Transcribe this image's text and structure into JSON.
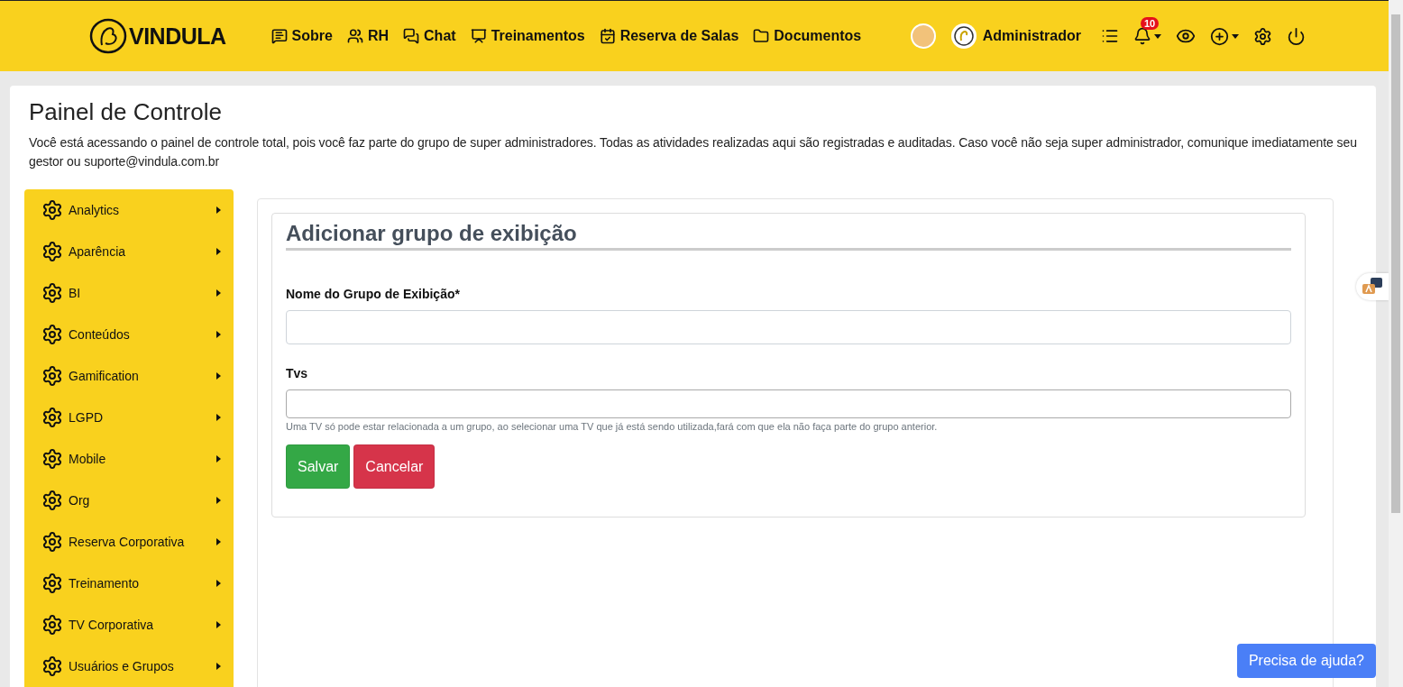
{
  "header": {
    "logo": "VINDULA",
    "nav": [
      {
        "kind": "info",
        "label": "Sobre"
      },
      {
        "kind": "people",
        "label": "RH"
      },
      {
        "kind": "chat",
        "label": "Chat"
      },
      {
        "kind": "training",
        "label": "Treinamentos"
      },
      {
        "kind": "calendar",
        "label": "Reserva de Salas"
      },
      {
        "kind": "folder",
        "label": "Documentos"
      }
    ],
    "user": "Administrador",
    "notifications": "10"
  },
  "page": {
    "title": "Painel de Controle",
    "description": "Você está acessando o painel de controle total, pois você faz parte do grupo de super administradores. Todas as atividades realizadas aqui são registradas e auditadas. Caso você não seja super administrador, comunique imediatamente seu gestor ou suporte@vindula.com.br"
  },
  "sidebar": {
    "items": [
      {
        "label": "Analytics"
      },
      {
        "label": "Aparência"
      },
      {
        "label": "BI"
      },
      {
        "label": "Conteúdos"
      },
      {
        "label": "Gamification"
      },
      {
        "label": "LGPD"
      },
      {
        "label": "Mobile"
      },
      {
        "label": "Org"
      },
      {
        "label": "Reserva Corporativa"
      },
      {
        "label": "Treinamento"
      },
      {
        "label": "TV Corporativa"
      },
      {
        "label": "Usuários e Grupos"
      }
    ]
  },
  "form": {
    "title": "Adicionar grupo de exibição",
    "fields": [
      {
        "kind": "text",
        "label": "Nome do Grupo de Exibição*"
      },
      {
        "kind": "select",
        "label": "Tvs",
        "help": "Uma TV só pode estar relacionada a um grupo, ao selecionar uma TV que já está sendo utilizada,fará com que ela não faça parte do grupo anterior."
      }
    ],
    "buttons": [
      {
        "kind": "primary",
        "label": "Salvar"
      },
      {
        "kind": "danger",
        "label": "Cancelar"
      }
    ]
  },
  "help_button": "Precisa de ajuda?"
}
